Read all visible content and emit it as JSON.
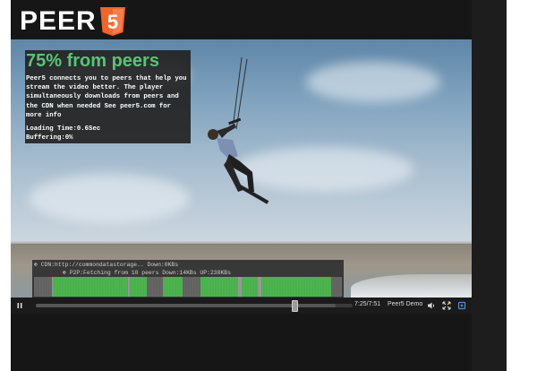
{
  "brand": {
    "logo_text": "PEER",
    "logo_badge": "5",
    "badge_color": "#f0652a"
  },
  "overlay": {
    "headline": "75% from peers",
    "description": "Peer5 connects you to peers that help you stream the video better. The player simultaneously downloads from peers and the CDN when needed See peer5.com for more info",
    "loading_time": "Loading Time:0.6Sec",
    "buffering": "Buffering:0%",
    "headline_color": "#58c477"
  },
  "diagnostics": {
    "cdn_line": "CDN:http://commondatastorage.. Down:0KBs",
    "p2p_line": "P2P:Fetching from 18 peers Down:14KBs UP:238KBs",
    "peer_count": 18,
    "chunk_colors": {
      "p2p": "#4db64f",
      "cdn": "#9a9a9a",
      "pending": "#666666"
    }
  },
  "controls": {
    "play_icon": "pause-icon",
    "time": "7:25/7:51",
    "title": "Peer5 Demo",
    "volume_icon": "volume-icon",
    "fullscreen_icon": "fullscreen-icon",
    "settings_icon": "settings-icon",
    "progress_fraction": 0.945
  }
}
